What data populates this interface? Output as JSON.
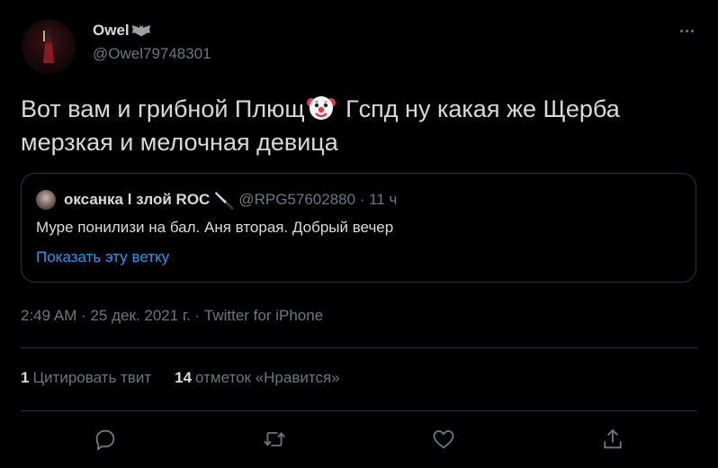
{
  "author": {
    "display_name": "Owel",
    "name_emoji": "bat-icon",
    "handle": "@Owel79748301"
  },
  "tweet": {
    "text_part1": "Вот вам и грибной Плющ",
    "inline_emoji": "clown-face-icon",
    "text_part2": " Гспд ну какая же Щерба мерзкая и мелочная девица"
  },
  "quoted": {
    "name": "оксанка l злой ROC",
    "name_emoji": "knife-icon",
    "handle_time": "@RPG57602880 · 11 ч",
    "text": "Муре понилизи на бал. Аня вторая. Добрый вечер",
    "thread_link": "Показать эту ветку"
  },
  "meta": {
    "line": "2:49 AM · 25 дек. 2021 г. · Twitter for iPhone"
  },
  "stats": {
    "quotes_count": "1",
    "quotes_label": "Цитировать твит",
    "likes_count": "14",
    "likes_label": "отметок «Нравится»"
  },
  "colors": {
    "background": "#000000",
    "text": "#d9d9d9",
    "secondary": "#6e767d",
    "link": "#1d9bf0",
    "border": "#2f3336"
  },
  "icons": [
    "more-icon",
    "reply-icon",
    "retweet-icon",
    "like-icon",
    "share-icon"
  ]
}
